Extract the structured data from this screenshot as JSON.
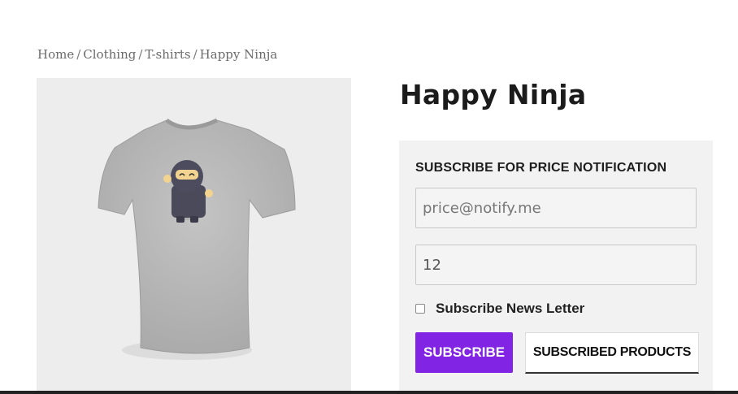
{
  "breadcrumb": {
    "items": [
      "Home",
      "Clothing",
      "T-shirts",
      "Happy Ninja"
    ],
    "separator": "/"
  },
  "product": {
    "title": "Happy Ninja",
    "image_icon": "ninja-tshirt-image"
  },
  "subscribe_form": {
    "heading": "SUBSCRIBE FOR PRICE NOTIFICATION",
    "email_placeholder": "price@notify.me",
    "quantity_value": "12",
    "newsletter_label": "Subscribe News Letter",
    "newsletter_checked": false,
    "subscribe_label": "SUBSCRIBE",
    "subscribed_products_label": "SUBSCRIBED PRODUCTS"
  },
  "colors": {
    "accent": "#8224e3",
    "panel_bg": "#f2f2f2",
    "image_bg": "#ededed"
  }
}
